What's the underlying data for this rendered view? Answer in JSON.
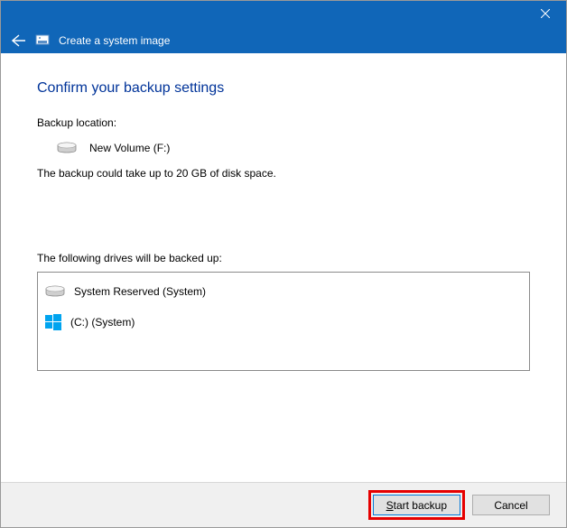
{
  "window": {
    "title": "Create a system image"
  },
  "page": {
    "heading": "Confirm your backup settings",
    "location_label": "Backup location:",
    "location_value": "New Volume (F:)",
    "size_estimate": "The backup could take up to 20 GB of disk space.",
    "drives_label": "The following drives will be backed up:"
  },
  "drives": [
    {
      "icon": "hdd",
      "label": "System Reserved (System)"
    },
    {
      "icon": "windows",
      "label": "(C:) (System)"
    }
  ],
  "buttons": {
    "start": "Start backup",
    "cancel": "Cancel"
  }
}
